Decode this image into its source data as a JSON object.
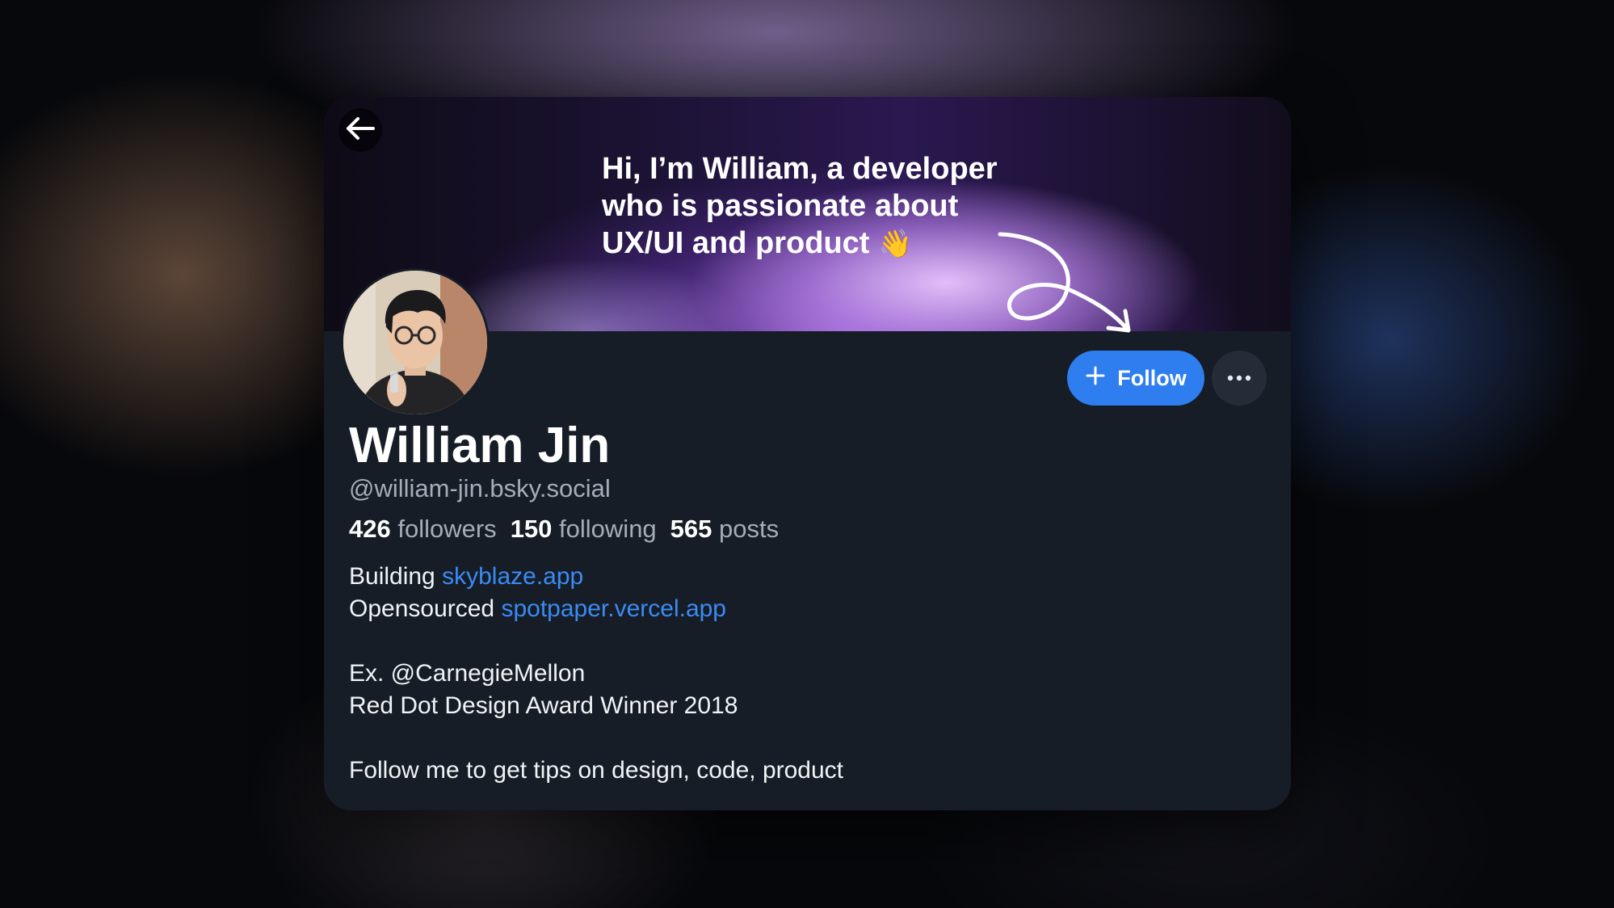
{
  "banner": {
    "lines": [
      "Hi, I’m William, a developer",
      "who is passionate about",
      "UX/UI and product"
    ],
    "wave_emoji": "👋"
  },
  "icons": {
    "back": "arrow-left-icon",
    "follow": "plus-icon",
    "more": "ellipsis-icon",
    "squiggle": "curly-arrow-icon"
  },
  "profile": {
    "name": "William Jin",
    "handle": "@william-jin.bsky.social",
    "followers_count": "426",
    "followers_label": "followers",
    "following_count": "150",
    "following_label": "following",
    "posts_count": "565",
    "posts_label": "posts"
  },
  "actions": {
    "follow_label": "Follow"
  },
  "bio": {
    "line1_prefix": "Building",
    "line1_link": "skyblaze.app",
    "line2_prefix": "Opensourced",
    "line2_link": "spotpaper.vercel.app",
    "line3": "Ex. @CarnegieMellon",
    "line4": "Red Dot Design Award Winner 2018",
    "line5": "Follow me to get tips on design, code, product"
  },
  "colors": {
    "card_bg": "#161d27",
    "accent": "#2f7ef0",
    "link": "#3b8bf4",
    "muted_text": "#a5adb8"
  }
}
